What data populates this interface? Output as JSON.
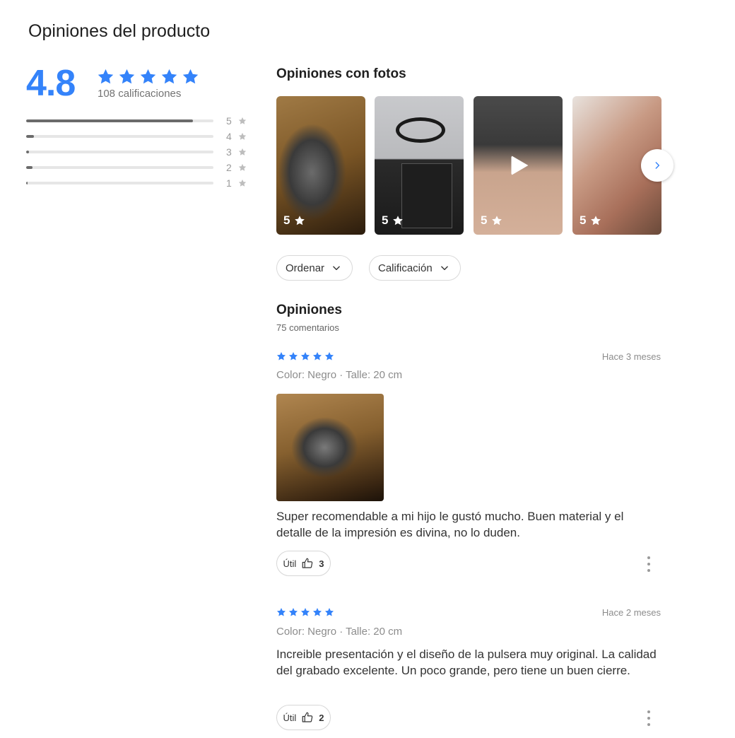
{
  "header": {
    "title": "Opiniones del producto"
  },
  "summary": {
    "average": "4.8",
    "stars": 5,
    "ratings_label": "108 calificaciones",
    "histogram": [
      {
        "label": "5",
        "fraction": 0.89
      },
      {
        "label": "4",
        "fraction": 0.04
      },
      {
        "label": "3",
        "fraction": 0.015
      },
      {
        "label": "2",
        "fraction": 0.035
      },
      {
        "label": "1",
        "fraction": 0.008
      }
    ]
  },
  "photos": {
    "title": "Opiniones con fotos",
    "items": [
      {
        "rating": "5",
        "kind": "image"
      },
      {
        "rating": "5",
        "kind": "image"
      },
      {
        "rating": "5",
        "kind": "video"
      },
      {
        "rating": "5",
        "kind": "image"
      }
    ]
  },
  "filters": {
    "sort_label": "Ordenar",
    "rating_label": "Calificación"
  },
  "reviews": {
    "title": "Opiniones",
    "count_label": "75 comentarios",
    "items": [
      {
        "stars": 5,
        "date": "Hace 3 meses",
        "attributes": "Color: Negro · Talle: 20 cm",
        "text": "Super recomendable a mi hijo le gustó mucho. Buen material y el detalle de la impresión es divina, no lo duden.",
        "useful_label": "Útil",
        "useful_count": "3"
      },
      {
        "stars": 5,
        "date": "Hace 2 meses",
        "attributes": "Color: Negro · Talle: 20 cm",
        "text": "Increible presentación y el diseño de la pulsera muy original. La calidad del grabado excelente. Un poco grande, pero tiene un buen cierre.",
        "useful_label": "Útil",
        "useful_count": "2"
      }
    ]
  },
  "colors": {
    "accent": "#3483fa",
    "bar": "#6b6b6b",
    "track": "#e6e6e6"
  },
  "icons": {
    "star": "star-icon",
    "thumb": "thumbs-up-icon",
    "chevron": "chevron-down-icon",
    "next": "chevron-right-icon",
    "play": "play-icon",
    "more": "more-vertical-icon"
  }
}
